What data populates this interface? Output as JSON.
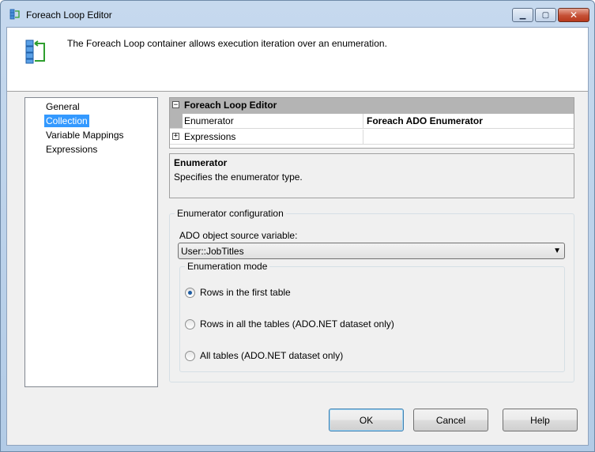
{
  "window": {
    "title": "Foreach Loop Editor",
    "caption_buttons": {
      "minimize": "▁",
      "maximize": "▢",
      "close": "✕"
    }
  },
  "header": {
    "description": "The Foreach Loop container allows execution iteration over an enumeration.",
    "icon": "foreach-loop-icon"
  },
  "nav": {
    "items": [
      {
        "label": "General",
        "selected": false
      },
      {
        "label": "Collection",
        "selected": true
      },
      {
        "label": "Variable Mappings",
        "selected": false
      },
      {
        "label": "Expressions",
        "selected": false
      }
    ]
  },
  "property_grid": {
    "category": "Foreach Loop Editor",
    "category_expander": "⊟",
    "rows": [
      {
        "name": "Enumerator",
        "value": "Foreach ADO Enumerator"
      },
      {
        "name": "Expressions",
        "value": "",
        "expander": "+"
      }
    ]
  },
  "help": {
    "title": "Enumerator",
    "description": "Specifies the enumerator type."
  },
  "config": {
    "group_label": "Enumerator configuration",
    "source_label": "ADO object source variable:",
    "source_value": "User::JobTitles",
    "mode_group_label": "Enumeration mode",
    "modes": [
      {
        "label": "Rows in the first table",
        "checked": true
      },
      {
        "label": "Rows in all the tables (ADO.NET dataset only)",
        "checked": false
      },
      {
        "label": "All tables (ADO.NET dataset only)",
        "checked": false
      }
    ]
  },
  "buttons": {
    "ok": "OK",
    "cancel": "Cancel",
    "help": "Help"
  },
  "colors": {
    "selection": "#3399ff",
    "grid_category": "#b4b4b4",
    "dialog_bg": "#f0f0f0",
    "title_bar": "#c6d9ee",
    "close_button": "#c55035"
  }
}
